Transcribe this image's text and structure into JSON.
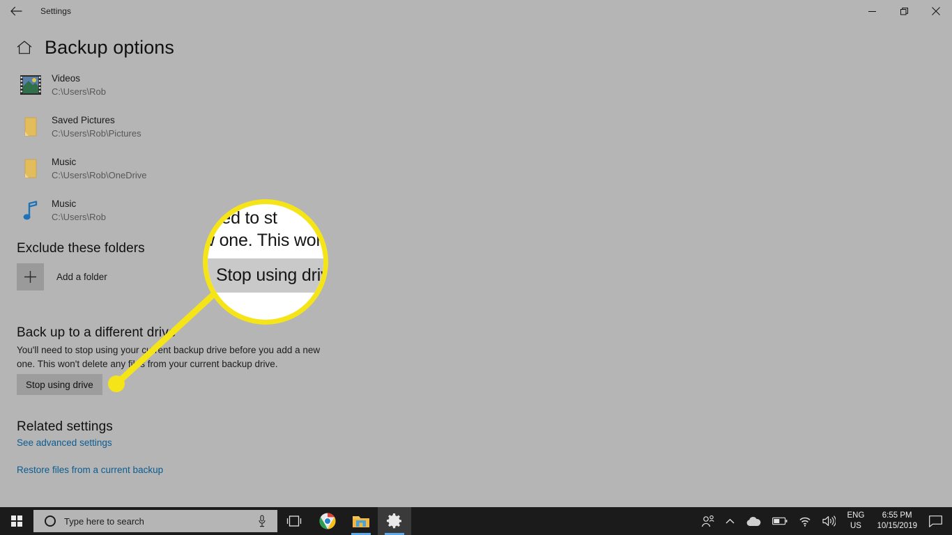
{
  "window": {
    "title": "Settings",
    "back_icon": "back-arrow-icon",
    "minimize_label": "Minimize",
    "restore_label": "Restore",
    "close_label": "Close"
  },
  "page": {
    "home_icon": "home-icon",
    "title": "Backup options"
  },
  "folders": [
    {
      "icon": "video-thumbnail-icon",
      "name": "Videos",
      "path": "C:\\Users\\Rob"
    },
    {
      "icon": "folder-icon",
      "name": "Saved Pictures",
      "path": "C:\\Users\\Rob\\Pictures"
    },
    {
      "icon": "folder-icon",
      "name": "Music",
      "path": "C:\\Users\\Rob\\OneDrive"
    },
    {
      "icon": "music-note-icon",
      "name": "Music",
      "path": "C:\\Users\\Rob"
    }
  ],
  "exclude": {
    "heading": "Exclude these folders",
    "add_icon": "plus-icon",
    "add_label": "Add a folder"
  },
  "different_drive": {
    "heading": "Back up to a different drive",
    "description": "You'll need to stop using your current backup drive before you add a new one. This won't delete any files from your current backup drive.",
    "button_label": "Stop using drive"
  },
  "related": {
    "heading": "Related settings",
    "link_advanced": "See advanced settings",
    "link_restore": "Restore files from a current backup",
    "link_color": "#0a5c91"
  },
  "callout": {
    "highlight_color": "#f5e518",
    "magnified_line1": "need to st",
    "magnified_line2": "w one. This won",
    "magnified_button": "Stop using drive"
  },
  "taskbar": {
    "start_icon": "windows-logo-icon",
    "search_circle_icon": "cortana-circle-icon",
    "search_placeholder": "Type here to search",
    "search_value": "",
    "mic_icon": "microphone-icon",
    "apps": [
      {
        "icon": "task-view-icon",
        "label": "Task View",
        "active": false,
        "open": false
      },
      {
        "icon": "chrome-icon",
        "label": "Google Chrome",
        "active": false,
        "open": true
      },
      {
        "icon": "file-explorer-icon",
        "label": "File Explorer",
        "active": false,
        "open": true
      },
      {
        "icon": "settings-gear-icon",
        "label": "Settings",
        "active": true,
        "open": true
      }
    ],
    "tray": {
      "people_icon": "people-icon",
      "chevron_icon": "chevron-up-icon",
      "onedrive_icon": "onedrive-cloud-icon",
      "battery_icon": "battery-icon",
      "wifi_icon": "wifi-icon",
      "volume_icon": "speaker-icon",
      "lang_line1": "ENG",
      "lang_line2": "US",
      "time": "6:55 PM",
      "date": "10/15/2019",
      "notification_icon": "notification-icon"
    }
  }
}
